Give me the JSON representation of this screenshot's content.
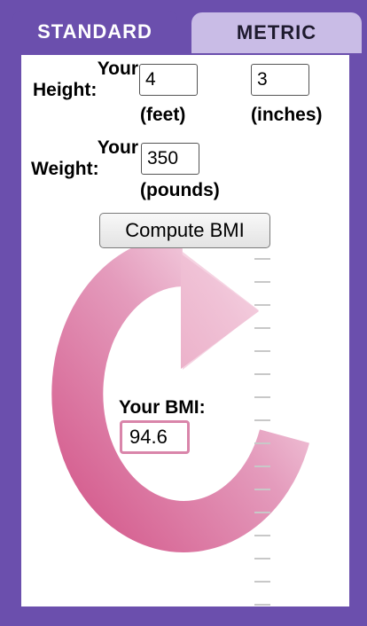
{
  "tabs": [
    {
      "label": "STANDARD",
      "active": true
    },
    {
      "label": "METRIC",
      "active": false
    }
  ],
  "height": {
    "label_line1": "Your",
    "label_line2": "Height:",
    "feet_value": "4",
    "feet_unit": "(feet)",
    "inches_value": "3",
    "inches_unit": "(inches)"
  },
  "weight": {
    "label_line1": "Your",
    "label_line2": "Weight:",
    "value": "350",
    "unit": "(pounds)"
  },
  "compute_button": "Compute BMI",
  "result": {
    "label": "Your BMI:",
    "value": "94.6"
  },
  "colors": {
    "frame": "#6b4fad",
    "metric_tab": "#c9bce6",
    "arrow": "#d45a8c",
    "result_border": "#d985aa"
  },
  "icons": [
    "circular-arrow-icon",
    "scale-ruler"
  ]
}
